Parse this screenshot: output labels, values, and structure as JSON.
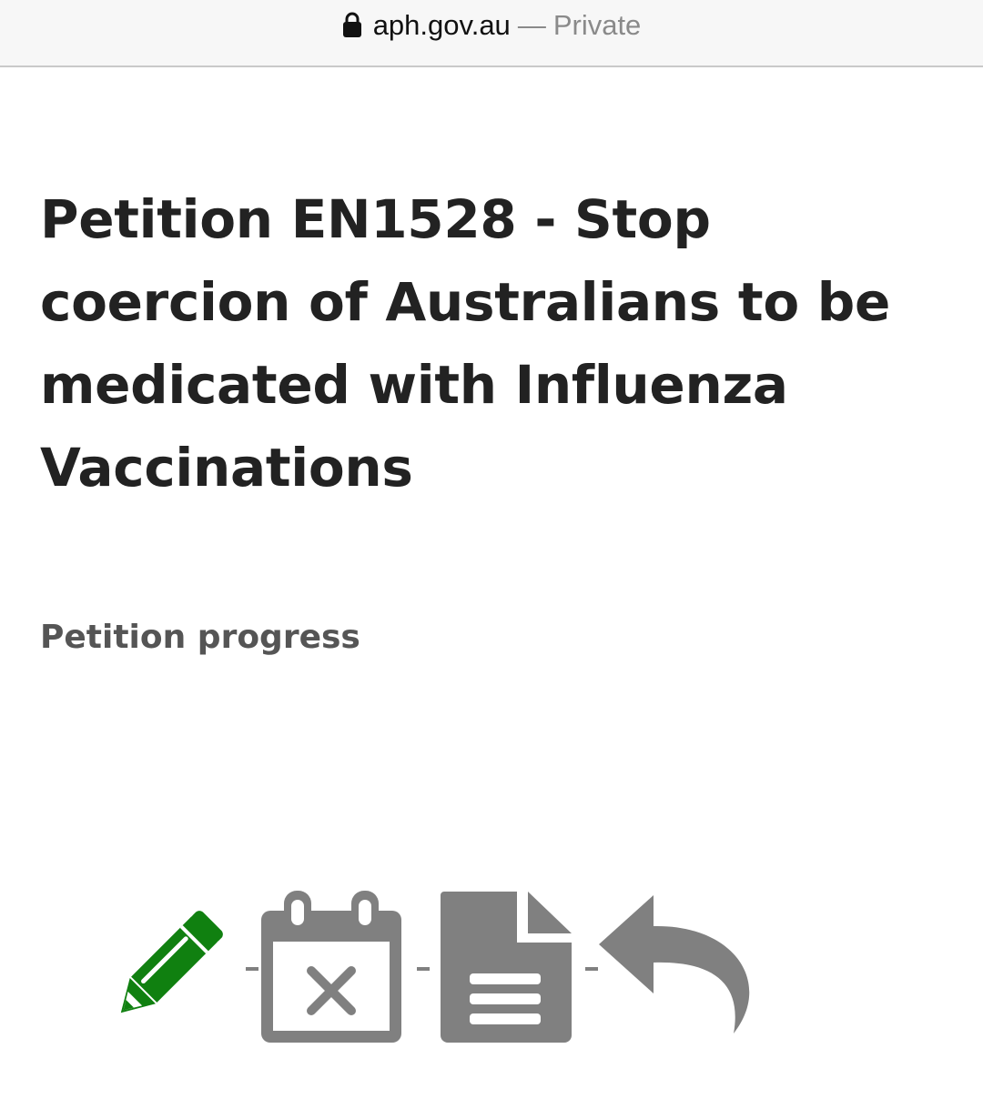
{
  "browser": {
    "domain": "aph.gov.au",
    "separator": "—",
    "mode": "Private",
    "lock_icon": "lock-icon"
  },
  "page": {
    "title": "Petition EN1528 - Stop coercion of Australians to be medicated with Influenza Vaccinations",
    "section_heading": "Petition progress"
  },
  "progress": {
    "steps": [
      {
        "icon": "pencil-icon",
        "state": "active",
        "color": "#108010"
      },
      {
        "icon": "calendar-x-icon",
        "state": "inactive",
        "color": "#808080"
      },
      {
        "icon": "document-icon",
        "state": "inactive",
        "color": "#808080"
      },
      {
        "icon": "reply-arrow-icon",
        "state": "inactive",
        "color": "#808080"
      }
    ]
  },
  "colors": {
    "active": "#108010",
    "inactive": "#808080",
    "title_text": "#222222",
    "heading_text": "#555555"
  }
}
